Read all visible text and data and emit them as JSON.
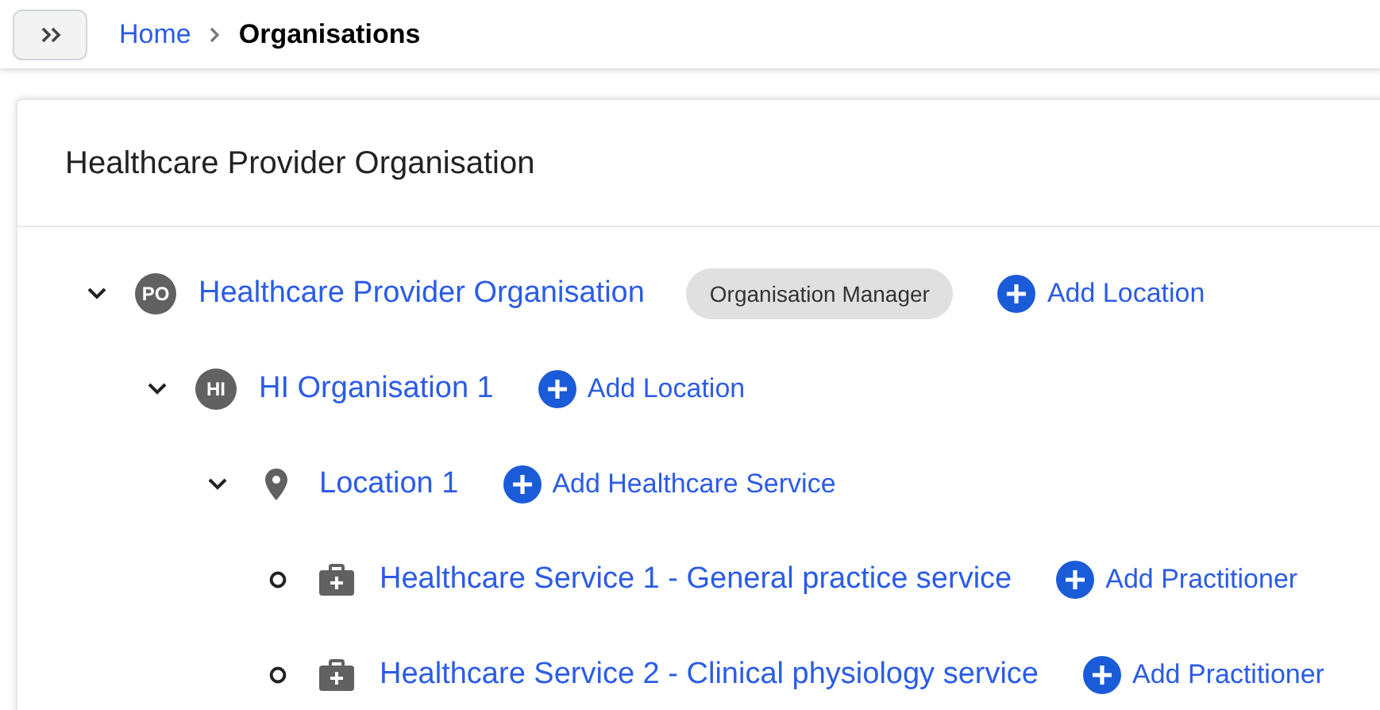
{
  "breadcrumb": [
    {
      "label": "Home",
      "current": false
    },
    {
      "label": "Organisations",
      "current": true
    }
  ],
  "card": {
    "title": "Healthcare Provider Organisation"
  },
  "tree": [
    {
      "kind": "organisation",
      "initials": "PO",
      "name": "Healthcare Provider Organisation",
      "expanded": true,
      "badge": "Organisation Manager",
      "action": "Add Location",
      "children": [
        {
          "kind": "organisation",
          "initials": "HI",
          "name": "HI Organisation 1",
          "expanded": true,
          "action": "Add Location",
          "children": [
            {
              "kind": "location",
              "name": "Location 1",
              "expanded": true,
              "action": "Add Healthcare Service",
              "children": [
                {
                  "kind": "service",
                  "name": "Healthcare Service 1 - General practice service",
                  "action": "Add Practitioner"
                },
                {
                  "kind": "service",
                  "name": "Healthcare Service 2 - Clinical physiology service",
                  "action": "Add Practitioner"
                }
              ]
            }
          ]
        }
      ]
    }
  ]
}
